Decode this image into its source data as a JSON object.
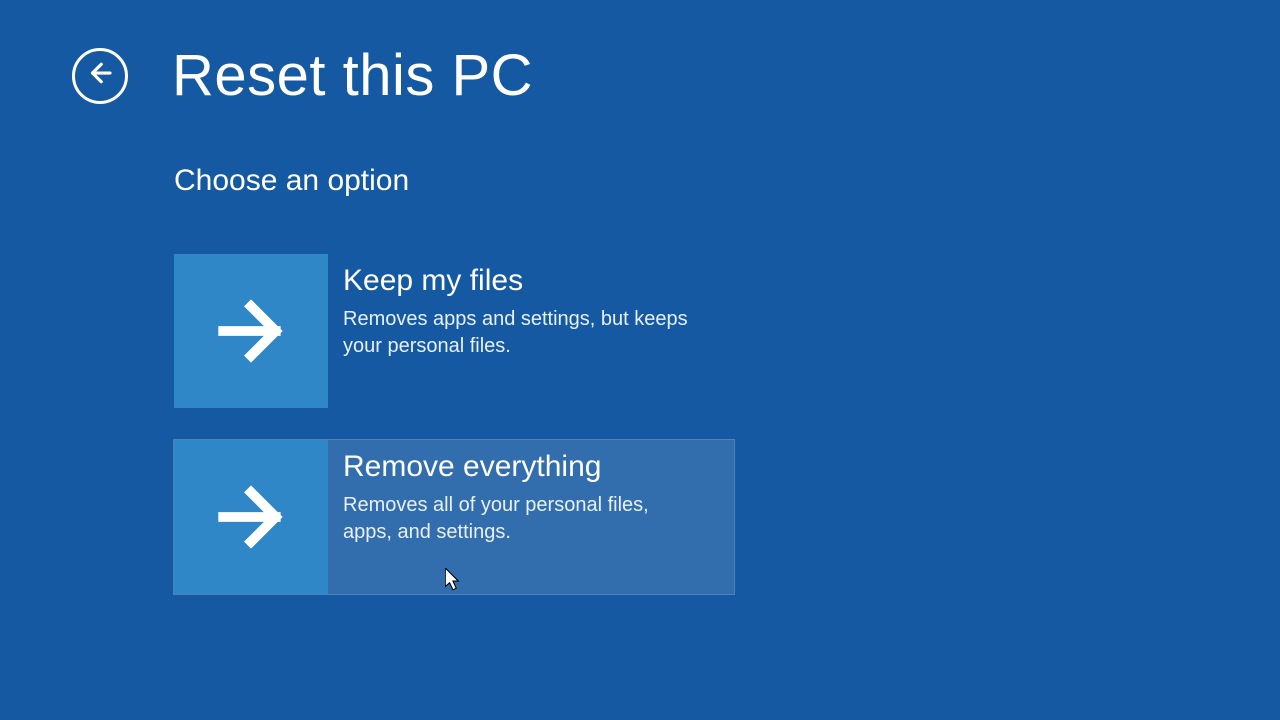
{
  "header": {
    "title": "Reset this PC"
  },
  "subtitle": "Choose an option",
  "options": [
    {
      "title": "Keep my files",
      "description": "Removes apps and settings, but keeps your personal files."
    },
    {
      "title": "Remove everything",
      "description": "Removes all of your personal files, apps, and settings."
    }
  ]
}
